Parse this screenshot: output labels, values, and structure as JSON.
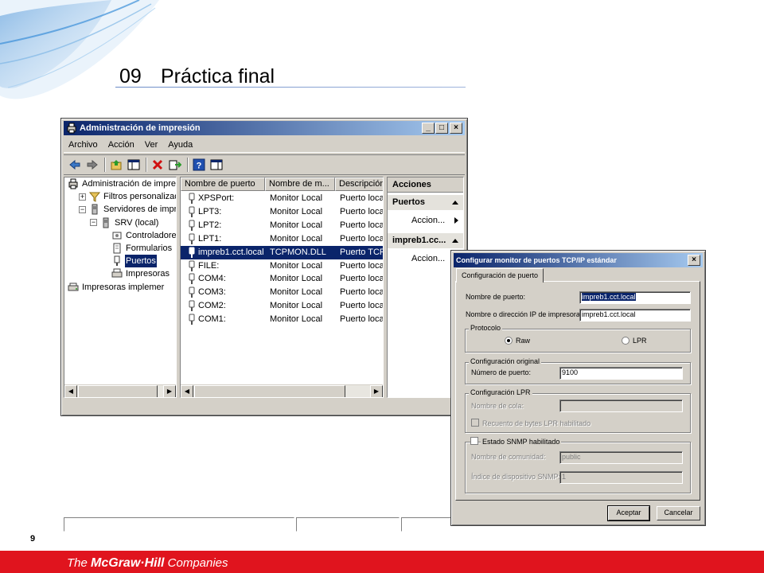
{
  "slide": {
    "number": "09",
    "title": "Práctica final",
    "page": "9"
  },
  "footer": {
    "brand_prefix": "The ",
    "brand_name": "McGraw·Hill",
    "brand_suffix": " Companies"
  },
  "mmc": {
    "title": "Administración de impresión",
    "caption_buttons": {
      "minimize": "_",
      "maximize": "□",
      "close": "×"
    },
    "menu": [
      "Archivo",
      "Acción",
      "Ver",
      "Ayuda"
    ],
    "toolbar_icons": [
      "back-arrow-icon",
      "forward-arrow-icon",
      "up-folder-icon",
      "show-hide-tree-icon",
      "delete-icon",
      "export-icon",
      "help-icon",
      "properties-pane-icon"
    ],
    "tree": [
      {
        "label": "Administración de impres",
        "indent": 0,
        "expander": "",
        "icon": "print-management-icon"
      },
      {
        "label": "Filtros personalizado",
        "indent": 1,
        "expander": "+",
        "icon": "filter-icon"
      },
      {
        "label": "Servidores de impres",
        "indent": 1,
        "expander": "−",
        "icon": "server-icon"
      },
      {
        "label": "SRV (local)",
        "indent": 2,
        "expander": "−",
        "icon": "server-icon"
      },
      {
        "label": "Controladore",
        "indent": 3,
        "expander": "",
        "icon": "driver-icon"
      },
      {
        "label": "Formularios",
        "indent": 3,
        "expander": "",
        "icon": "forms-icon"
      },
      {
        "label": "Puertos",
        "indent": 3,
        "expander": "",
        "icon": "port-icon",
        "selected": true
      },
      {
        "label": "Impresoras",
        "indent": 3,
        "expander": "",
        "icon": "printer-icon"
      },
      {
        "label": "Impresoras implemer",
        "indent": 0,
        "expander": "",
        "icon": "deployed-printers-icon"
      }
    ],
    "list_columns": [
      "Nombre de puerto",
      "Nombre de m...",
      "Descripción"
    ],
    "ports": [
      {
        "name": "XPSPort:",
        "monitor": "Monitor Local",
        "desc": "Puerto loca"
      },
      {
        "name": "LPT3:",
        "monitor": "Monitor Local",
        "desc": "Puerto loca"
      },
      {
        "name": "LPT2:",
        "monitor": "Monitor Local",
        "desc": "Puerto loca"
      },
      {
        "name": "LPT1:",
        "monitor": "Monitor Local",
        "desc": "Puerto loca"
      },
      {
        "name": "impreb1.cct.local",
        "monitor": "TCPMON.DLL",
        "desc": "Puerto TCP",
        "selected": true
      },
      {
        "name": "FILE:",
        "monitor": "Monitor Local",
        "desc": "Puerto loca"
      },
      {
        "name": "COM4:",
        "monitor": "Monitor Local",
        "desc": "Puerto loca"
      },
      {
        "name": "COM3:",
        "monitor": "Monitor Local",
        "desc": "Puerto loca"
      },
      {
        "name": "COM2:",
        "monitor": "Monitor Local",
        "desc": "Puerto loca"
      },
      {
        "name": "COM1:",
        "monitor": "Monitor Local",
        "desc": "Puerto loca"
      }
    ],
    "actions": {
      "header": "Acciones",
      "group1": "Puertos",
      "group1_item": "Accion...",
      "group2": "impreb1.cc...",
      "group2_item": "Accion..."
    }
  },
  "dialog": {
    "title": "Configurar monitor de puertos TCP/IP estándar",
    "close": "×",
    "tab": "Configuración de puerto",
    "port_name_label": "Nombre de puerto:",
    "port_name_value": "impreb1.cct.local",
    "ip_label": "Nombre o dirección IP de impresora:",
    "ip_value": "impreb1.cct.local",
    "protocol_group": "Protocolo",
    "raw_label": "Raw",
    "lpr_label": "LPR",
    "original_group": "Configuración original",
    "port_number_label": "Número de puerto:",
    "port_number_value": "9100",
    "lpr_group": "Configuración LPR",
    "queue_label": "Nombre de cola:",
    "byte_count_label": "Recuento de bytes LPR habilitado",
    "snmp_label": "Estado SNMP habilitado",
    "community_label": "Nombre de comunidad:",
    "community_value": "public",
    "snmp_index_label": "Índice de dispositivo SNMP:",
    "snmp_index_value": "1",
    "ok": "Aceptar",
    "cancel": "Cancelar"
  }
}
